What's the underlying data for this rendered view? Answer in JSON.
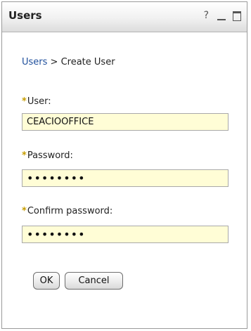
{
  "window": {
    "title": "Users",
    "help_symbol": "?",
    "controls": [
      "minimize-icon",
      "maximize-icon"
    ]
  },
  "breadcrumb": {
    "link": "Users",
    "separator": " > ",
    "current": "Create User"
  },
  "form": {
    "required_marker": "*",
    "user": {
      "label": "User:",
      "value": "CEACIOOFFICE"
    },
    "password": {
      "label": "Password:",
      "value": "........"
    },
    "confirm": {
      "label": "Confirm password:",
      "value": "........"
    }
  },
  "buttons": {
    "ok": "OK",
    "cancel": "Cancel"
  },
  "colors": {
    "input_bg": "#fffdd6",
    "link": "#1f4f9c",
    "required": "#c69c00"
  }
}
